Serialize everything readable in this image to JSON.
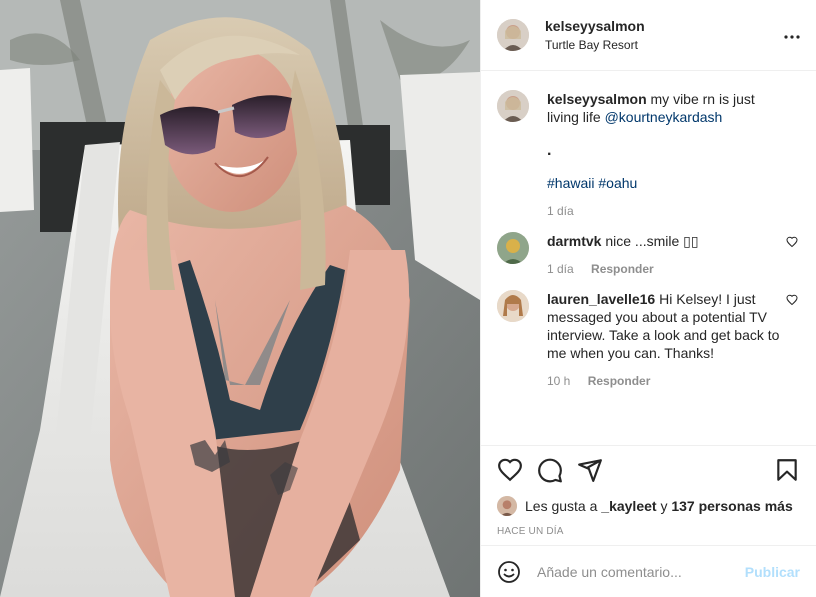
{
  "post": {
    "username": "kelseyysalmon",
    "location": "Turtle Bay Resort",
    "more_icon": "more-horizontal-icon"
  },
  "caption": {
    "username": "kelseyysalmon",
    "text": "my vibe rn is just living life",
    "mention": "@kourtneykardash",
    "dot": ".",
    "hashtags": [
      "#hawaii",
      "#oahu"
    ],
    "time": "1 día"
  },
  "comments": [
    {
      "username": "darmtvk",
      "text": "nice ...smile ▯▯",
      "time": "1 día",
      "reply_label": "Responder"
    },
    {
      "username": "lauren_lavelle16",
      "text": "Hi Kelsey! I just messaged you about a potential TV interview. Take a look and get back to me when you can. Thanks!",
      "time": "10 h",
      "reply_label": "Responder"
    }
  ],
  "likes": {
    "prefix": "Les gusta a",
    "user": "_kayleet",
    "connector": "y",
    "others": "137 personas más"
  },
  "posted_ago": "HACE UN DÍA",
  "add_comment": {
    "placeholder": "Añade un comentario...",
    "publish_label": "Publicar"
  },
  "icons": {
    "like": "heart-icon",
    "comment": "comment-icon",
    "share": "share-icon",
    "save": "bookmark-icon",
    "emoji": "smiley-icon"
  },
  "colors": {
    "link": "#00376b",
    "muted": "#8e8e8e",
    "publish": "#b2dffc",
    "text": "#262626"
  }
}
